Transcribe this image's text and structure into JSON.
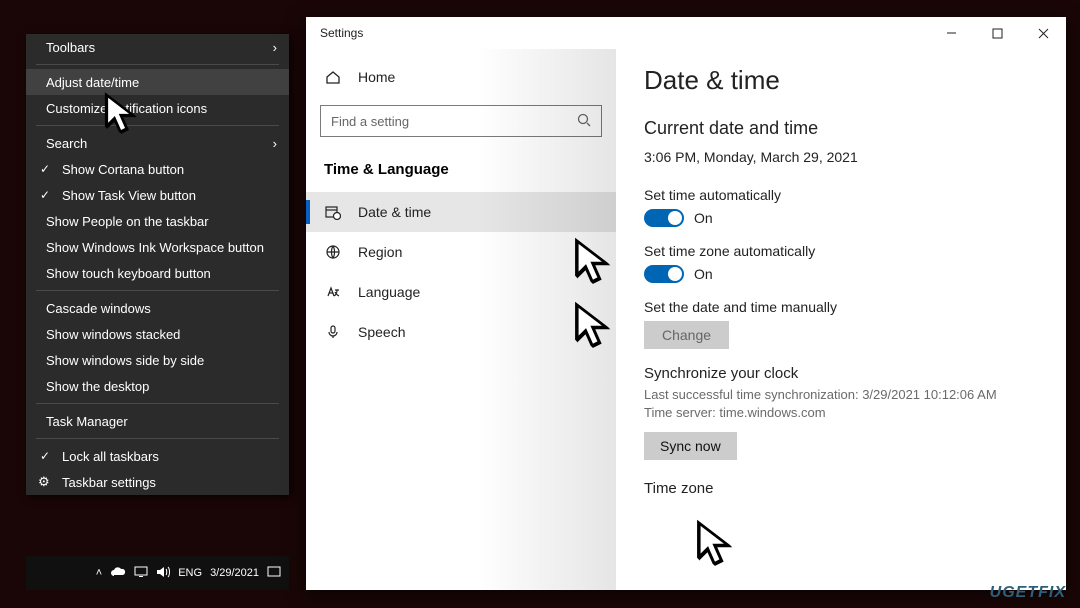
{
  "context_menu": {
    "toolbars": "Toolbars",
    "adjust_date_time": "Adjust date/time",
    "customize_notification_icons": "Customize notification icons",
    "search": "Search",
    "show_cortana_button": "Show Cortana button",
    "show_task_view_button": "Show Task View button",
    "show_people_on_taskbar": "Show People on the taskbar",
    "show_windows_ink_workspace": "Show Windows Ink Workspace button",
    "show_touch_keyboard": "Show touch keyboard button",
    "cascade_windows": "Cascade windows",
    "show_windows_stacked": "Show windows stacked",
    "show_windows_side_by_side": "Show windows side by side",
    "show_the_desktop": "Show the desktop",
    "task_manager": "Task Manager",
    "lock_all_taskbars": "Lock all taskbars",
    "taskbar_settings": "Taskbar settings"
  },
  "taskbar": {
    "lang": "ENG",
    "date": "3/29/2021"
  },
  "settings": {
    "title": "Settings",
    "home": "Home",
    "search_placeholder": "Find a setting",
    "section_heading": "Time & Language",
    "nav": {
      "date_time": "Date & time",
      "region": "Region",
      "language": "Language",
      "speech": "Speech"
    }
  },
  "page": {
    "heading": "Date & time",
    "current_heading": "Current date and time",
    "current_value": "3:06 PM, Monday, March 29, 2021",
    "set_time_auto_label": "Set time automatically",
    "set_time_auto_state": "On",
    "set_tz_auto_label": "Set time zone automatically",
    "set_tz_auto_state": "On",
    "set_manual_label": "Set the date and time manually",
    "change_button": "Change",
    "sync_heading": "Synchronize your clock",
    "sync_last": "Last successful time synchronization: 3/29/2021 10:12:06 AM",
    "sync_server": "Time server: time.windows.com",
    "sync_button": "Sync now",
    "tz_heading": "Time zone"
  },
  "watermark": "UGETFIX"
}
